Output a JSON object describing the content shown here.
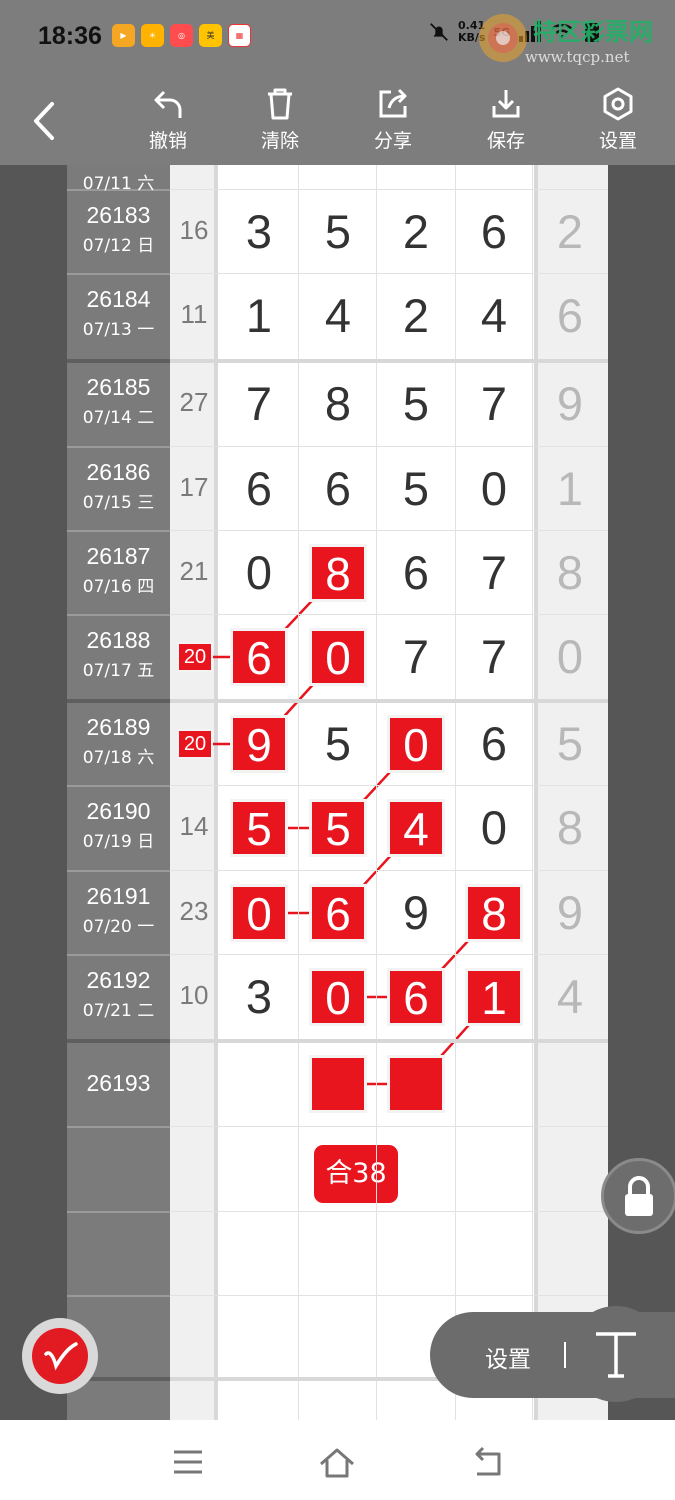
{
  "status_bar": {
    "time": "18:36",
    "net_speed_value": "0.41",
    "net_speed_unit": "KB/s",
    "network_type": "5G",
    "apps": [
      {
        "name": "video-app-icon",
        "color": "#f7b500"
      },
      {
        "name": "sun-app-icon",
        "color": "#ffb300"
      },
      {
        "name": "camera-app-icon",
        "color": "#ff4d4f"
      },
      {
        "name": "meituan-app-icon",
        "color": "#ffc300"
      },
      {
        "name": "calendar-app-icon",
        "color": "#ff5a5a"
      }
    ]
  },
  "watermark": {
    "site_name": "特区彩票网",
    "url": "www.tqcp.net"
  },
  "toolbar": {
    "undo_label": "撤销",
    "clear_label": "清除",
    "share_label": "分享",
    "save_label": "保存",
    "settings_label": "设置"
  },
  "rows": [
    {
      "issue": "",
      "date": "07/11 六",
      "sum": "",
      "digits": [
        "",
        "",
        "",
        "",
        ""
      ]
    },
    {
      "issue": "26183",
      "date": "07/12 日",
      "sum": "16",
      "digits": [
        "3",
        "5",
        "2",
        "6",
        "2"
      ]
    },
    {
      "issue": "26184",
      "date": "07/13 一",
      "sum": "11",
      "digits": [
        "1",
        "4",
        "2",
        "4",
        "6"
      ]
    },
    {
      "issue": "26185",
      "date": "07/14 二",
      "sum": "27",
      "digits": [
        "7",
        "8",
        "5",
        "7",
        "9"
      ]
    },
    {
      "issue": "26186",
      "date": "07/15 三",
      "sum": "17",
      "digits": [
        "6",
        "6",
        "5",
        "0",
        "1"
      ]
    },
    {
      "issue": "26187",
      "date": "07/16 四",
      "sum": "21",
      "digits": [
        "0",
        "8",
        "6",
        "7",
        "8"
      ]
    },
    {
      "issue": "26188",
      "date": "07/17 五",
      "sum": "20",
      "digits": [
        "6",
        "0",
        "7",
        "7",
        "0"
      ]
    },
    {
      "issue": "26189",
      "date": "07/18 六",
      "sum": "20",
      "digits": [
        "9",
        "5",
        "0",
        "6",
        "5"
      ]
    },
    {
      "issue": "26190",
      "date": "07/19 日",
      "sum": "14",
      "digits": [
        "5",
        "5",
        "4",
        "0",
        "8"
      ]
    },
    {
      "issue": "26191",
      "date": "07/20 一",
      "sum": "23",
      "digits": [
        "0",
        "6",
        "9",
        "8",
        "9"
      ]
    },
    {
      "issue": "26192",
      "date": "07/21 二",
      "sum": "10",
      "digits": [
        "3",
        "0",
        "6",
        "1",
        "4"
      ]
    },
    {
      "issue": "26193",
      "date": "",
      "sum": "",
      "digits": [
        "",
        "",
        "",
        "",
        ""
      ]
    }
  ],
  "highlighted_sums": [
    {
      "row": 6,
      "value": "20"
    },
    {
      "row": 7,
      "value": "20"
    }
  ],
  "highlights": [
    {
      "row": 5,
      "col": 1,
      "value": "8"
    },
    {
      "row": 6,
      "col": 0,
      "value": "6"
    },
    {
      "row": 6,
      "col": 1,
      "value": "0"
    },
    {
      "row": 7,
      "col": 0,
      "value": "9"
    },
    {
      "row": 7,
      "col": 2,
      "value": "0"
    },
    {
      "row": 8,
      "col": 0,
      "value": "5"
    },
    {
      "row": 8,
      "col": 1,
      "value": "5"
    },
    {
      "row": 8,
      "col": 2,
      "value": "4"
    },
    {
      "row": 9,
      "col": 0,
      "value": "0"
    },
    {
      "row": 9,
      "col": 1,
      "value": "6"
    },
    {
      "row": 9,
      "col": 3,
      "value": "8"
    },
    {
      "row": 10,
      "col": 1,
      "value": "0"
    },
    {
      "row": 10,
      "col": 2,
      "value": "6"
    },
    {
      "row": 10,
      "col": 3,
      "value": "1"
    },
    {
      "row": 11,
      "col": 1,
      "value": ""
    },
    {
      "row": 11,
      "col": 2,
      "value": ""
    }
  ],
  "connections": [
    {
      "from": [
        5,
        1
      ],
      "to": [
        6,
        0
      ]
    },
    {
      "from": [
        6,
        0
      ],
      "to": [
        6,
        -1
      ]
    },
    {
      "from": [
        6,
        1
      ],
      "to": [
        7,
        0
      ]
    },
    {
      "from": [
        7,
        0
      ],
      "to": [
        7,
        -1
      ]
    },
    {
      "from": [
        7,
        2
      ],
      "to": [
        8,
        1
      ]
    },
    {
      "from": [
        8,
        0
      ],
      "to": [
        8,
        1
      ]
    },
    {
      "from": [
        8,
        2
      ],
      "to": [
        9,
        1
      ]
    },
    {
      "from": [
        9,
        0
      ],
      "to": [
        9,
        1
      ]
    },
    {
      "from": [
        9,
        3
      ],
      "to": [
        10,
        2
      ]
    },
    {
      "from": [
        10,
        1
      ],
      "to": [
        10,
        2
      ]
    },
    {
      "from": [
        10,
        3
      ],
      "to": [
        11,
        2
      ]
    },
    {
      "from": [
        11,
        1
      ],
      "to": [
        11,
        2
      ]
    }
  ],
  "sum_badge": "合38",
  "floating": {
    "settings_label": "设置"
  },
  "colors": {
    "highlight": "#e8141e",
    "toolbar_bg": "#7d7d7d",
    "label_bg": "#7b7b7b"
  }
}
